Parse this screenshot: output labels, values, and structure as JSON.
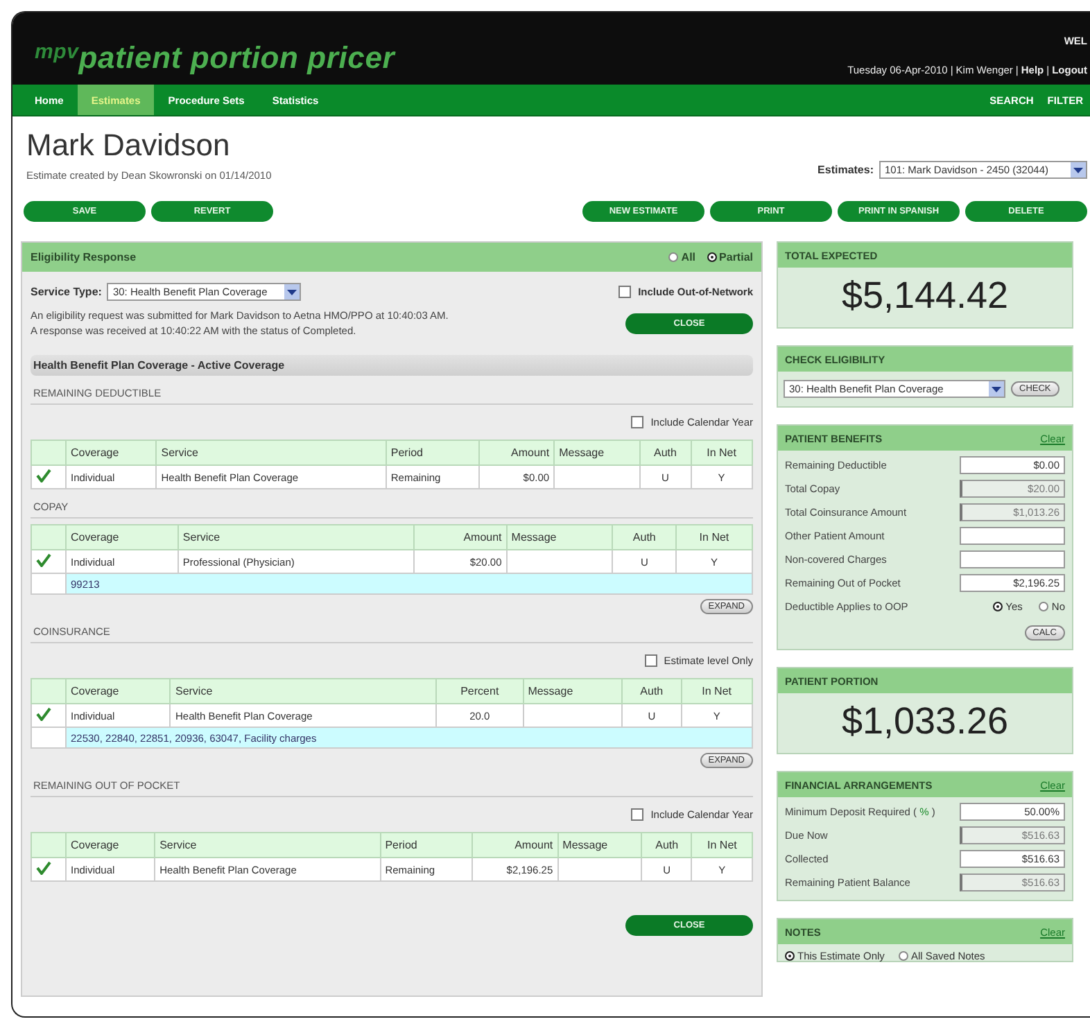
{
  "header": {
    "logo_prefix": "mpv",
    "logo": "patient portion pricer",
    "welcome": "WEL",
    "separator": "|",
    "user_line": [
      {
        "text": "Tuesday 06-Apr-2010",
        "kind": "text"
      },
      {
        "text": "Kim Wenger",
        "kind": "text"
      },
      {
        "text": "Help",
        "kind": "link"
      },
      {
        "text": "Logout",
        "kind": "link"
      }
    ]
  },
  "nav": {
    "items": [
      {
        "label": "Home",
        "selected": false
      },
      {
        "label": "Estimates",
        "selected": true
      },
      {
        "label": "Procedure Sets",
        "selected": false
      },
      {
        "label": "Statistics",
        "selected": false
      }
    ],
    "right": [
      "SEARCH",
      "FILTER"
    ]
  },
  "patient": {
    "name": "Mark Davidson",
    "created": "Estimate created by Dean Skowronski on 01/14/2010",
    "estimates_label": "Estimates:",
    "estimates_value": "101: Mark Davidson - 2450 (32044)"
  },
  "actions": {
    "left": [
      "SAVE",
      "REVERT"
    ],
    "right": [
      "NEW ESTIMATE",
      "PRINT",
      "PRINT IN SPANISH",
      "DELETE"
    ]
  },
  "eligibility": {
    "title": "Eligibility Response",
    "filters": [
      {
        "label": "All",
        "selected": false
      },
      {
        "label": "Partial",
        "selected": true
      }
    ],
    "service_type_label": "Service Type:",
    "service_type": "30: Health Benefit Plan Coverage",
    "out_of_network": {
      "label": "Include Out-of-Network",
      "checked": false
    },
    "messages": [
      "An eligibility request was submitted for Mark Davidson to Aetna HMO/PPO at 10:40:03 AM.",
      "A response was received at 10:40:22 AM with the status of Completed."
    ],
    "close": "CLOSE",
    "coverage_title": "Health Benefit Plan Coverage - Active Coverage",
    "sections": [
      {
        "title": "REMAINING DEDUCTIBLE",
        "option": {
          "label": "Include Calendar Year",
          "checked": false
        },
        "columns": [
          {
            "label": "Coverage",
            "kind": "text"
          },
          {
            "label": "Service",
            "kind": "text"
          },
          {
            "label": "Period",
            "kind": "text"
          },
          {
            "label": "Amount",
            "kind": "money"
          },
          {
            "label": "Message",
            "kind": "blank"
          },
          {
            "label": "Auth",
            "kind": "center"
          },
          {
            "label": "In Net",
            "kind": "center"
          }
        ],
        "rows": [
          {
            "checked": true,
            "cells": [
              "Individual",
              "Health Benefit Plan Coverage",
              "Remaining",
              "$0.00",
              "",
              "U",
              "Y"
            ]
          }
        ]
      },
      {
        "title": "COPAY",
        "columns": [
          {
            "label": "Coverage",
            "kind": "text"
          },
          {
            "label": "Service",
            "kind": "text"
          },
          {
            "label": "Amount",
            "kind": "money"
          },
          {
            "label": "Message",
            "kind": "blank"
          },
          {
            "label": "Auth",
            "kind": "center"
          },
          {
            "label": "In Net",
            "kind": "center"
          }
        ],
        "rows": [
          {
            "checked": true,
            "cells": [
              "Individual",
              "Professional (Physician)",
              "$20.00",
              "",
              "U",
              "Y"
            ]
          }
        ],
        "note": "99213",
        "button": "EXPAND"
      },
      {
        "title": "COINSURANCE",
        "option": {
          "label": "Estimate level Only",
          "checked": false
        },
        "columns": [
          {
            "label": "Coverage",
            "kind": "text"
          },
          {
            "label": "Service",
            "kind": "text"
          },
          {
            "label": "Percent",
            "kind": "center"
          },
          {
            "label": "Message",
            "kind": "blank"
          },
          {
            "label": "Auth",
            "kind": "center"
          },
          {
            "label": "In Net",
            "kind": "center"
          }
        ],
        "rows": [
          {
            "checked": true,
            "cells": [
              "Individual",
              "Health Benefit Plan Coverage",
              "20.0",
              "",
              "U",
              "Y"
            ]
          }
        ],
        "note": "22530, 22840, 22851, 20936, 63047, Facility charges",
        "button": "EXPAND"
      },
      {
        "title": "REMAINING OUT OF POCKET",
        "option": {
          "label": "Include Calendar Year",
          "checked": false
        },
        "columns": [
          {
            "label": "Coverage",
            "kind": "text"
          },
          {
            "label": "Service",
            "kind": "text"
          },
          {
            "label": "Period",
            "kind": "text"
          },
          {
            "label": "Amount",
            "kind": "money"
          },
          {
            "label": "Message",
            "kind": "blank"
          },
          {
            "label": "Auth",
            "kind": "center"
          },
          {
            "label": "In Net",
            "kind": "center"
          }
        ],
        "rows": [
          {
            "checked": true,
            "cells": [
              "Individual",
              "Health Benefit Plan Coverage",
              "Remaining",
              "$2,196.25",
              "",
              "U",
              "Y"
            ]
          }
        ]
      }
    ],
    "bottom_button": "CLOSE"
  },
  "total_expected": {
    "title": "TOTAL EXPECTED",
    "amount": "$5,144.42"
  },
  "check_eligibility": {
    "title": "CHECK ELIGIBILITY",
    "value": "30: Health Benefit Plan Coverage",
    "button": "CHECK"
  },
  "patient_benefits": {
    "title": "PATIENT BENEFITS",
    "link": "Clear",
    "fields": [
      {
        "label": "Remaining Deductible",
        "value": "$0.00",
        "disabled": false
      },
      {
        "label": "Total Copay",
        "value": "$20.00",
        "disabled": true
      },
      {
        "label": "Total Coinsurance Amount",
        "value": "$1,013.26",
        "disabled": true
      },
      {
        "label": "Other Patient Amount",
        "disabled": false
      },
      {
        "label": "Non-covered Charges",
        "disabled": false
      },
      {
        "label": "Remaining Out of Pocket",
        "value": "$2,196.25",
        "disabled": false
      }
    ],
    "oop_label": "Deductible Applies to OOP",
    "oop_options": [
      {
        "label": "Yes",
        "selected": true
      },
      {
        "label": "No",
        "selected": false
      }
    ],
    "button": "CALC"
  },
  "patient_portion": {
    "title": "PATIENT PORTION",
    "amount": "$1,033.26"
  },
  "financial": {
    "title": "FINANCIAL ARRANGEMENTS",
    "link": "Clear",
    "fields": [
      {
        "label": "Minimum Deposit Required (",
        "link": "%",
        "label_end": ")",
        "value": "50.00%",
        "disabled": false
      },
      {
        "label": "Due Now",
        "value": "$516.63",
        "disabled": true
      },
      {
        "label": "Collected",
        "value": "$516.63",
        "disabled": false
      },
      {
        "label": "Remaining Patient Balance",
        "value": "$516.63",
        "disabled": true
      }
    ]
  },
  "notes": {
    "title": "NOTES",
    "link": "Clear",
    "options": [
      {
        "label": "This Estimate Only",
        "selected": true
      },
      {
        "label": "All Saved Notes",
        "selected": false
      }
    ]
  }
}
